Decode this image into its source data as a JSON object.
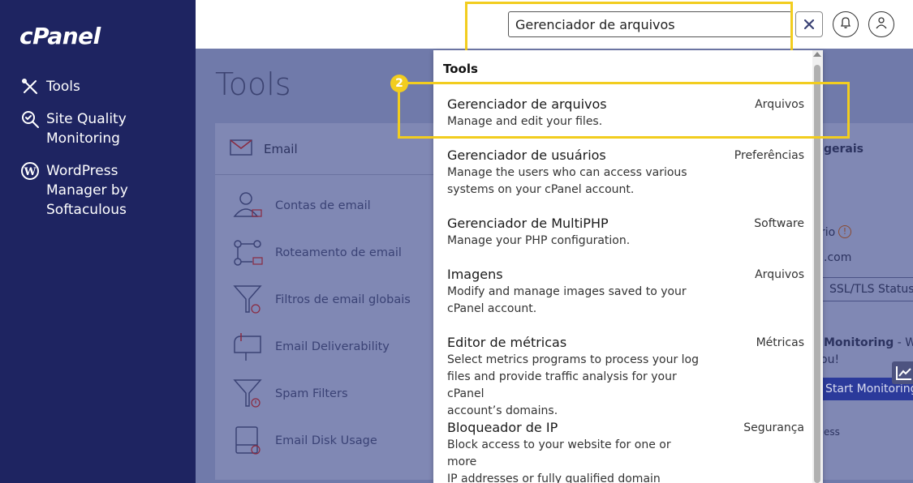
{
  "sidebar": {
    "logo": "cPanel",
    "items": [
      {
        "label": "Tools",
        "icon": "tools-icon"
      },
      {
        "label": "Site Quality\nMonitoring",
        "icon": "search-check-icon"
      },
      {
        "label": "WordPress\nManager by\nSoftaculous",
        "icon": "wordpress-icon"
      }
    ]
  },
  "header": {
    "search_value": "Gerenciador de arquivos",
    "clear_icon": "close-icon",
    "notifications_icon": "bell-icon",
    "user_icon": "user-icon"
  },
  "main": {
    "title": "Tools",
    "email_section": {
      "label": "Email",
      "items": [
        {
          "label": "Contas de email"
        },
        {
          "label": "Roteamento de email"
        },
        {
          "label": "Filtros de email globais"
        },
        {
          "label": "Email Deliverability"
        },
        {
          "label": "Spam Filters"
        },
        {
          "label": "Email Disk Usage"
        }
      ]
    },
    "right_panel": {
      "heading_fragment": "gerais",
      "usuario_fragment": "rio",
      "domain_fragment": ".com",
      "ssl_button": "SSL/TLS Status",
      "monitoring_bold": "Monitoring",
      "monitoring_rest": " - We'",
      "monitoring_line2": "ou!",
      "start_button": "Start Monitoring",
      "bottom_fragment": "ess"
    }
  },
  "dropdown": {
    "header": "Tools",
    "results": [
      {
        "title": "Gerenciador de arquivos",
        "desc": "Manage and edit your files.",
        "category": "Arquivos"
      },
      {
        "title": "Gerenciador de usuários",
        "desc": "Manage the users who can access various\nsystems on your cPanel account.",
        "category": "Preferências"
      },
      {
        "title": "Gerenciador de MultiPHP",
        "desc": "Manage your PHP configuration.",
        "category": "Software"
      },
      {
        "title": "Imagens",
        "desc": "Modify and manage images saved to your\ncPanel account.",
        "category": "Arquivos"
      },
      {
        "title": "Editor de métricas",
        "desc": "Select metrics programs to process your log\nfiles and provide traffic analysis for your cPanel\naccount’s domains.",
        "category": "Métricas"
      },
      {
        "title": "Bloqueador de IP",
        "desc": "Block access to your website for one or more\nIP addresses or fully qualified domain names.",
        "category": "Segurança"
      }
    ]
  },
  "annotation": {
    "step": "2"
  },
  "colors": {
    "sidebar_bg": "#1e2461",
    "highlight": "#f2cd1f",
    "overlay": "#707aaa"
  }
}
